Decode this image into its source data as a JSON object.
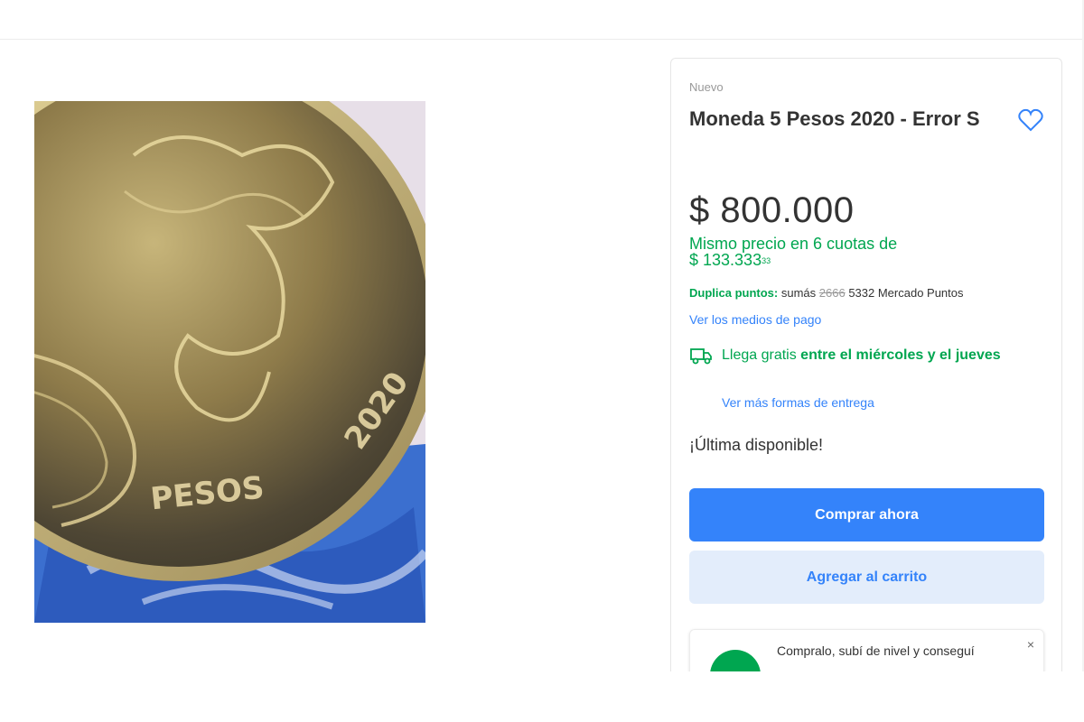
{
  "product": {
    "condition": "Nuevo",
    "title": "Moneda 5 Pesos 2020 - Error S",
    "price": "$ 800.000",
    "installments_text": "Mismo precio en 6 cuotas de",
    "installment_amount": "$ 133.333",
    "installment_cents": "33",
    "points_label": "Duplica puntos:",
    "points_prefix": "sumás",
    "points_old": "2666",
    "points_new": "5332 Mercado Puntos",
    "payment_link": "Ver los medios de pago",
    "shipping_free": "Llega gratis",
    "shipping_window": "entre el miércoles y el jueves",
    "shipping_link": "Ver más formas de entrega",
    "stock": "¡Última disponible!"
  },
  "actions": {
    "buy_now": "Comprar ahora",
    "add_to_cart": "Agregar al carrito"
  },
  "promo": {
    "text": "Compralo, subí de nivel y conseguí",
    "close": "×"
  },
  "image": {
    "coin_year": "2020",
    "coin_denomination": "PESOS"
  },
  "colors": {
    "accent": "#3483fa",
    "success": "#00a650",
    "cart_bg": "#e3edfb"
  }
}
